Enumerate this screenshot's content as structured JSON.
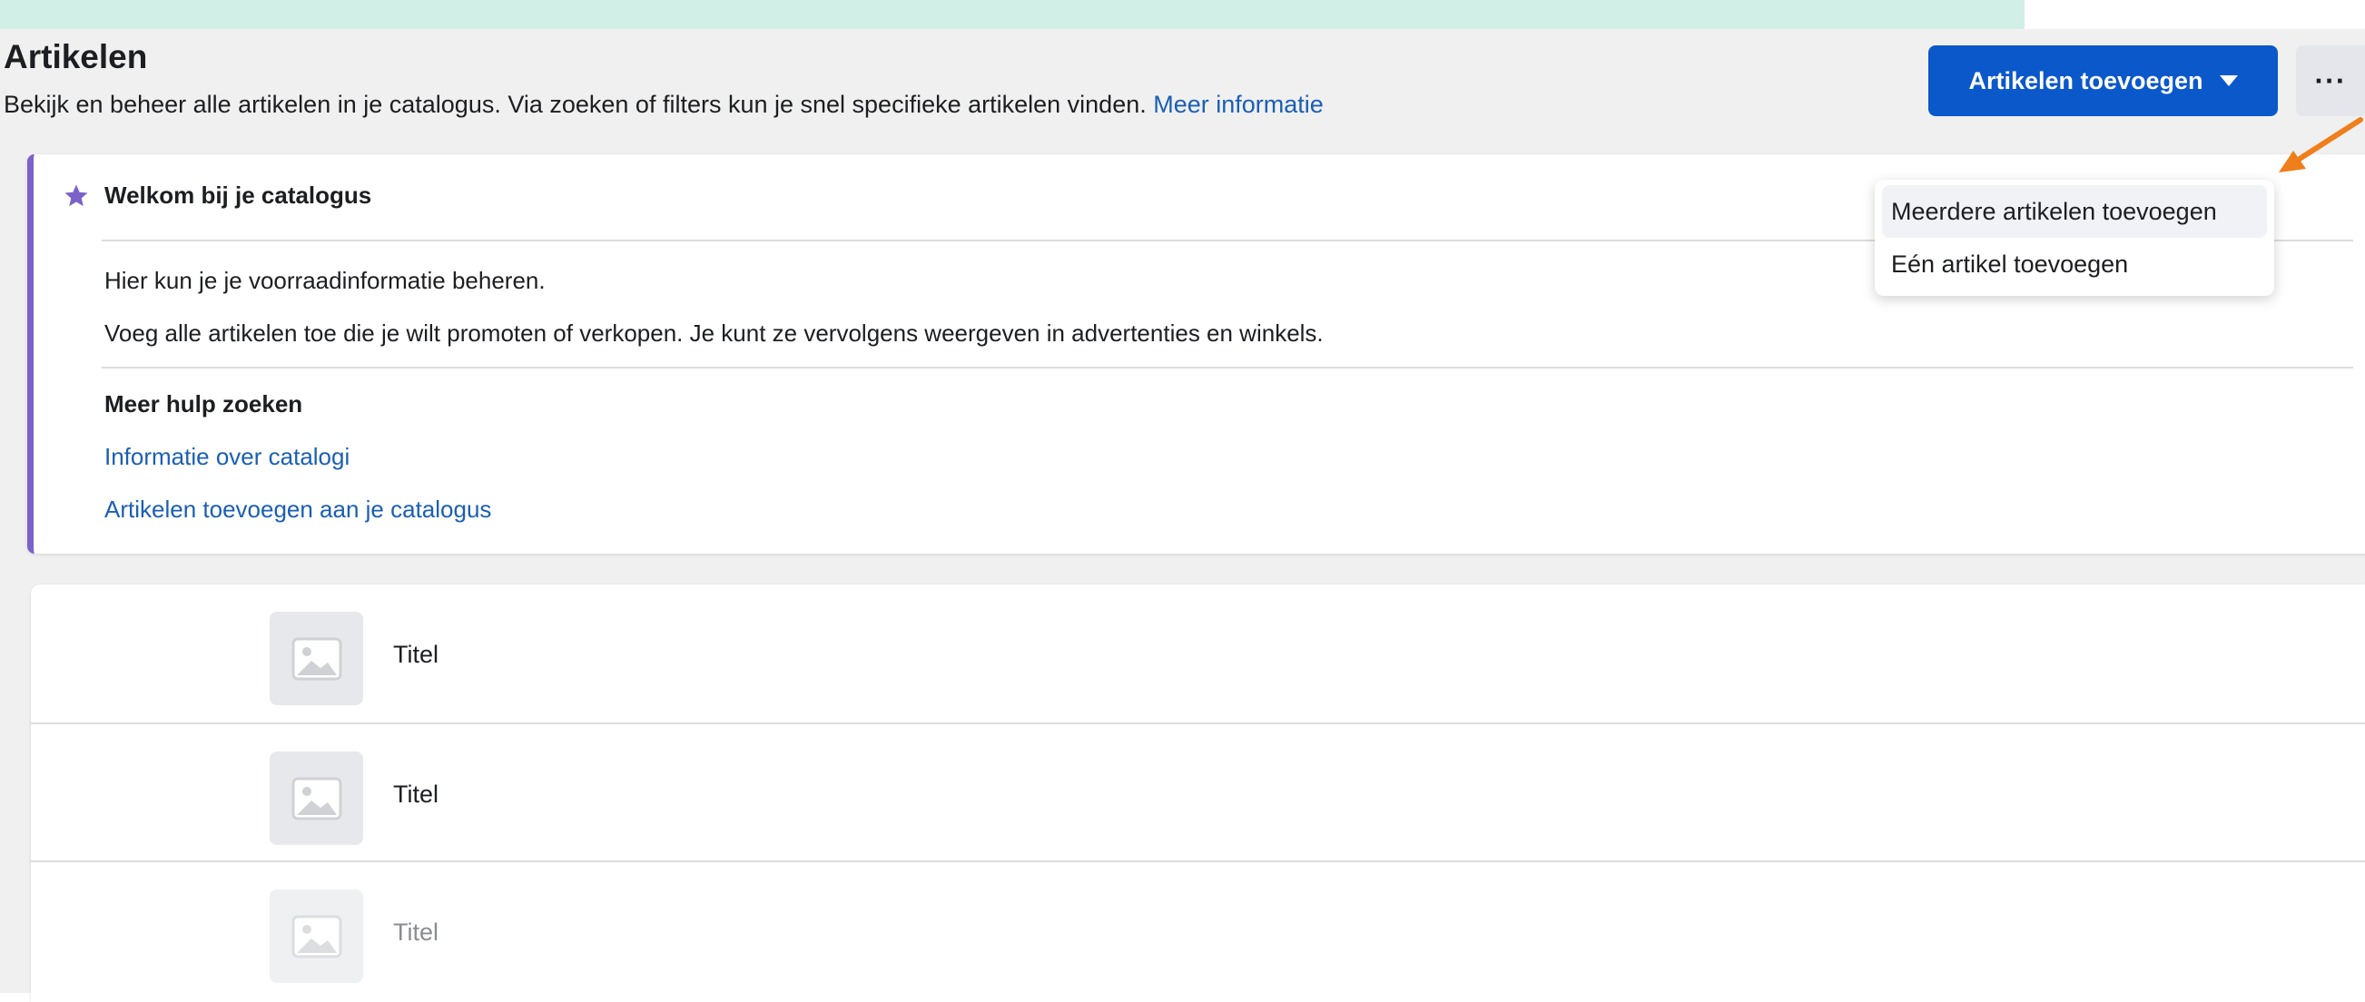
{
  "header": {
    "title": "Artikelen",
    "description": "Bekijk en beheer alle artikelen in je catalogus. Via zoeken of filters kun je snel specifieke artikelen vinden.",
    "more_info_link": "Meer informatie"
  },
  "toolbar": {
    "add_button_label": "Artikelen toevoegen",
    "more_button_label": "···"
  },
  "dropdown": {
    "items": [
      {
        "label": "Meerdere artikelen toevoegen"
      },
      {
        "label": "Eén artikel toevoegen"
      }
    ]
  },
  "welcome": {
    "title": "Welkom bij je catalogus",
    "line1": "Hier kun je je voorraadinformatie beheren.",
    "line2": "Voeg alle artikelen toe die je wilt promoten of verkopen. Je kunt ze vervolgens weergeven in advertenties en winkels.",
    "help_heading": "Meer hulp zoeken",
    "links": [
      "Informatie over catalogi",
      "Artikelen toevoegen aan je catalogus"
    ]
  },
  "list": {
    "rows": [
      {
        "title": "Titel"
      },
      {
        "title": "Titel"
      },
      {
        "title": "Titel"
      }
    ]
  },
  "colors": {
    "primary_button": "#0a58ca",
    "accent_purple": "#7b61c9",
    "link_blue": "#1a5fb4",
    "annotation_arrow": "#f07e1a",
    "background_teal": "#d2efe7"
  },
  "icons": [
    "star-icon",
    "caret-down-icon",
    "image-placeholder-icon",
    "arrow-annotation-icon"
  ]
}
